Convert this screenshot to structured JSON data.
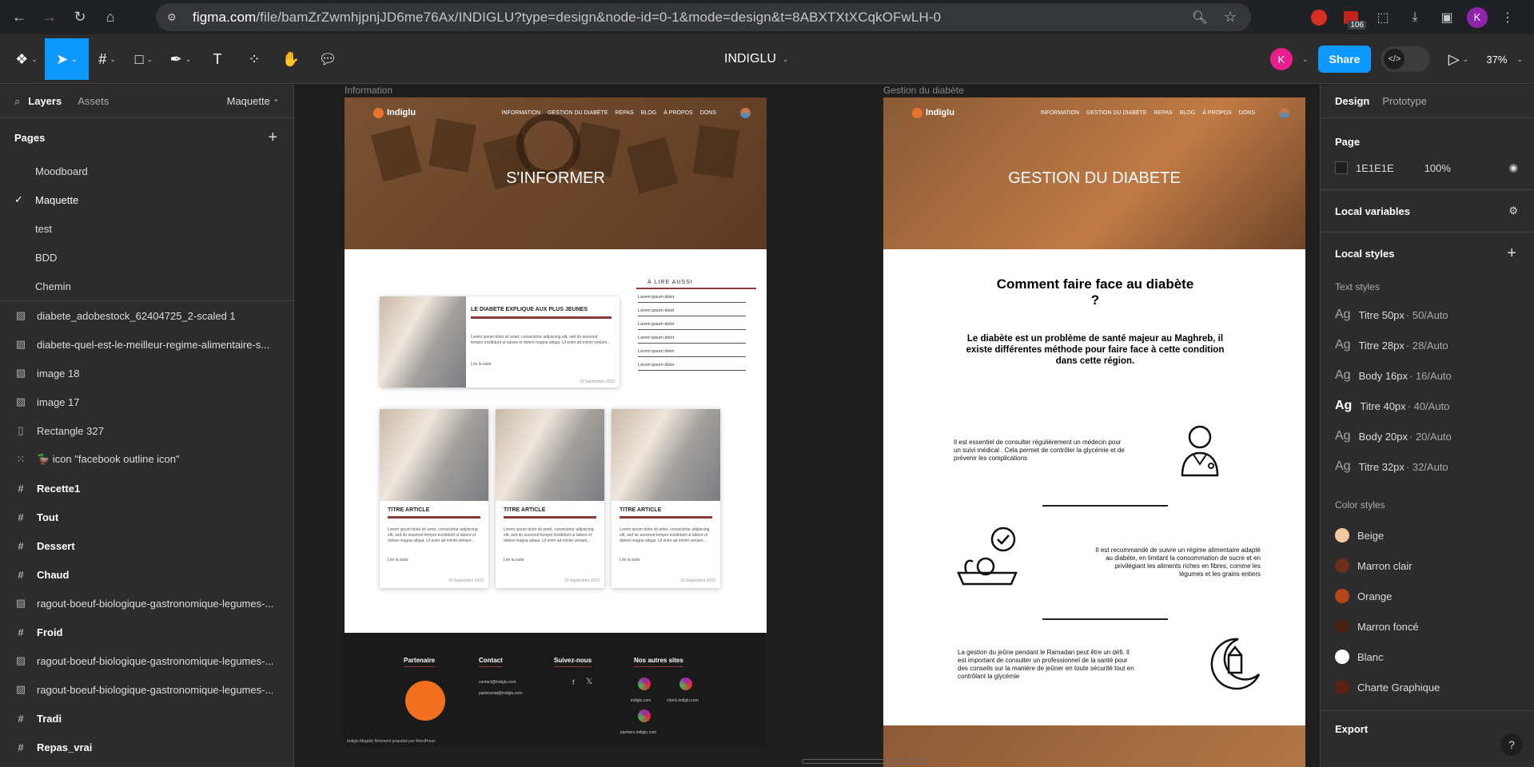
{
  "browser": {
    "url_domain": "figma.com",
    "url_rest": "/file/bamZrZwmhjpnjJD6me76Ax/INDIGLU?type=design&node-id=0-1&mode=design&t=8ABXTXtXCqkOFwLH-0",
    "ext_badge": "106",
    "profile_initial": "K"
  },
  "toolbar": {
    "file_name": "INDIGLU",
    "user_initial": "K",
    "share_label": "Share",
    "zoom": "37%"
  },
  "left_panel": {
    "tab_layers": "Layers",
    "tab_assets": "Assets",
    "current_page_select": "Maquette",
    "pages_header": "Pages",
    "pages": [
      {
        "label": "Moodboard"
      },
      {
        "label": "Maquette"
      },
      {
        "label": "test"
      },
      {
        "label": "BDD"
      },
      {
        "label": "Chemin"
      }
    ],
    "layers": [
      {
        "label": "diabete_adobestock_62404725_2-scaled 1"
      },
      {
        "label": "diabete-quel-est-le-meilleur-regime-alimentaire-s..."
      },
      {
        "label": "image 18"
      },
      {
        "label": "image 17"
      },
      {
        "label": "Rectangle 327"
      },
      {
        "label": "🦆 icon \"facebook outline icon\""
      },
      {
        "label": "Recette1"
      },
      {
        "label": "Tout"
      },
      {
        "label": "Dessert"
      },
      {
        "label": "Chaud"
      },
      {
        "label": "ragout-boeuf-biologique-gastronomique-legumes-..."
      },
      {
        "label": "Froid"
      },
      {
        "label": "ragout-boeuf-biologique-gastronomique-legumes-..."
      },
      {
        "label": "ragout-boeuf-biologique-gastronomique-legumes-..."
      },
      {
        "label": "Tradi"
      },
      {
        "label": "Repas_vrai"
      }
    ]
  },
  "canvas": {
    "frame1_label": "Information",
    "frame2_label": "Gestion du diabète",
    "site": {
      "logo": "Indiglu",
      "menu": [
        "INFORMATION",
        "GESTION DU DIABÈTE",
        "REPAS",
        "BLOG",
        "À PROPOS",
        "DONS"
      ]
    },
    "frame1": {
      "hero_title": "S'INFORMER",
      "featured_title": "LE DIABETE EXPLIQUE AUX PLUS JEUNES",
      "lorem": "Lorem ipsum dolor sit amet, consectetur adipiscing elit, sed do eiusmod tempor incididunt ut labore et dolore magna aliqua. Ut enim ad minim veniam...",
      "read_more": "Lire la suite",
      "date": "20 Septembre 2023",
      "aside_title": "À LIRE AUSSI",
      "aside_items": [
        "Lorem ipsum dolor",
        "Lorem ipsum dolor",
        "Lorem ipsum dolor",
        "Lorem ipsum dolor",
        "Lorem ipsum dolor",
        "Lorem ipsum dolor"
      ],
      "article_title": "TITRE ARTICLE",
      "footer": {
        "partner_h": "Partenaire",
        "contact_h": "Contact",
        "contact_1": "contact@indiglu.com",
        "contact_2": "partenariat@indiglu.com",
        "follow_h": "Suivez-nous",
        "sites_h": "Nos autres sites",
        "site_1": "indiglu.com",
        "site_2": "check.indiglu.com",
        "site_3": "partners.indiglu.com",
        "copyright": "Indiglu Magreb fièrement propulsé par WordPress"
      }
    },
    "frame2": {
      "hero_title": "GESTION DU DIABETE",
      "section_title": "Comment faire face au diabète ?",
      "intro": "Le diabète est un problème de santé majeur au Maghreb, il existe différentes méthode  pour faire face à cette condition dans cette région.",
      "p1": "Il est essentiel de consulter régulièrement un médecin  pour un suivi médical . Cela permet de contrôler la glycémie et de prévenir les complications",
      "p2": "Il est recommandé de suivre un régime alimentaire adapté au diabète, en limitant la consommation de sucre et en privilégiant les aliments riches en fibres, comme les légumes et les grains entiers",
      "p3": "La gestion du jeûne pendant le Ramadan peut être un défi. Il est important de consulter un professionnel de la santé pour des conseils sur la manière de jeûner en toute sécurité tout en contrôlant la glycémie"
    }
  },
  "right_panel": {
    "tab_design": "Design",
    "tab_prototype": "Prototype",
    "page_header": "Page",
    "page_color": "1E1E1E",
    "page_opacity": "100%",
    "local_variables": "Local variables",
    "local_styles": "Local styles",
    "text_styles_header": "Text styles",
    "text_styles": [
      {
        "name": "Titre 50px",
        "spec": "· 50/Auto"
      },
      {
        "name": "Titre 28px",
        "spec": "· 28/Auto"
      },
      {
        "name": "Body 16px",
        "spec": "· 16/Auto"
      },
      {
        "name": "Titre 40px",
        "spec": "· 40/Auto"
      },
      {
        "name": "Body 20px",
        "spec": "· 20/Auto"
      },
      {
        "name": "Titre 32px",
        "spec": "· 32/Auto"
      }
    ],
    "color_styles_header": "Color styles",
    "color_styles": [
      {
        "name": "Beige",
        "color": "#f5c9a0"
      },
      {
        "name": "Marron clair",
        "color": "#6b2f1a"
      },
      {
        "name": "Orange",
        "color": "#b5461c"
      },
      {
        "name": "Marron foncé",
        "color": "#4a2214"
      },
      {
        "name": "Blanc",
        "color": "#ffffff"
      },
      {
        "name": "Charte Graphique",
        "color": "#5a2414"
      }
    ],
    "export": "Export"
  }
}
